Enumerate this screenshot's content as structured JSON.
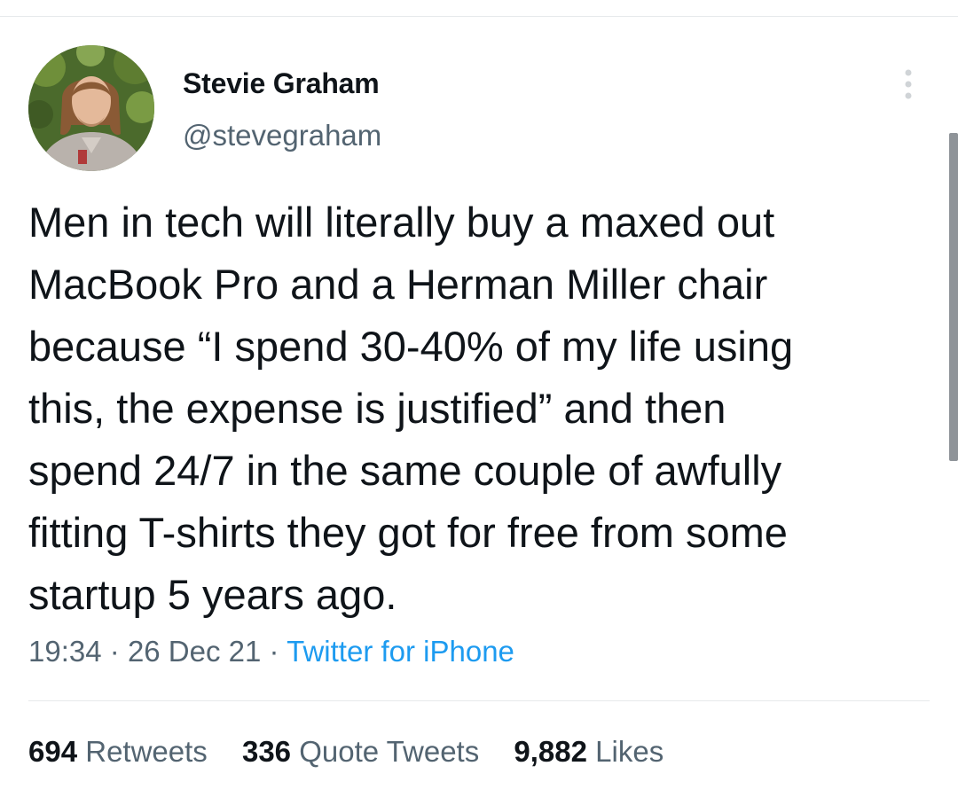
{
  "tweet": {
    "author": {
      "name": "Stevie Graham",
      "handle": "@stevegraham",
      "avatar_icon": "avatar-photo"
    },
    "text_lines": [
      "Men in tech will literally buy a maxed out",
      "MacBook Pro and a Herman Miller chair",
      "because “I spend 30-40% of my life using",
      "this, the expense is justified” and then",
      "spend 24/7 in the same couple of awfully",
      "fitting T-shirts they got for free from some",
      "startup 5 years ago."
    ],
    "time": "19:34",
    "separator": "·",
    "date": "26 Dec 21",
    "source": "Twitter for iPhone",
    "stats": [
      {
        "count": "694",
        "label": "Retweets"
      },
      {
        "count": "336",
        "label": "Quote Tweets"
      },
      {
        "count": "9,882",
        "label": "Likes"
      }
    ]
  },
  "icons": {
    "more": "more-options-icon"
  },
  "colors": {
    "text_primary": "#0f1419",
    "text_secondary": "#536471",
    "link": "#1d9bf0",
    "divider": "#e6e9eb"
  }
}
